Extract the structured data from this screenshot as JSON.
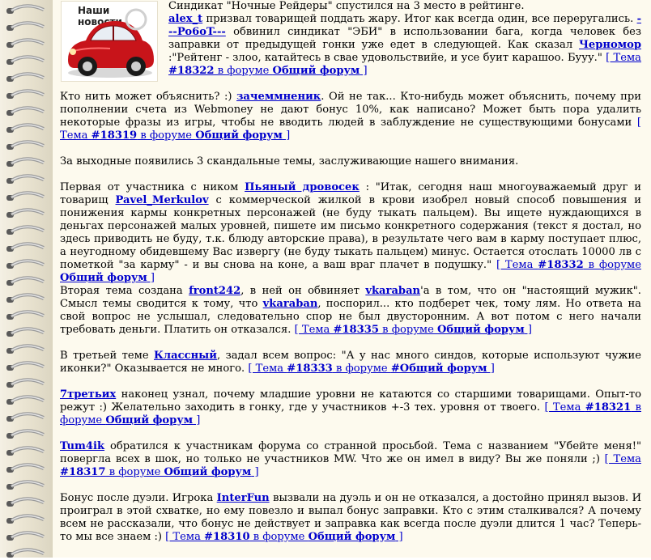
{
  "image": {
    "label": "Наши новости"
  },
  "p1": {
    "lead": "Синдикат \"Ночные Рейдеры\" спустился на 3 место в рейтинге.",
    "u1": "alex_t",
    "t1": " призвал товарищей поддать жару. Итог как всегда один, все переругались.",
    "u2": "---Po6oT---",
    "t2": " обвинил синдикат \"ЭБИ\" в использовании бага, когда человек без заправки от предыдущей гонки уже едет в следующей. Как сказал ",
    "u3": "Черномор",
    "t3": " :\"Рейтенг - злоо, катайтесь в свае удовольствийе, и усе буит карашоо. Бууу.\" ",
    "link_pre": "[ Тема ",
    "link_num": "#18322",
    "link_mid": " в форуме ",
    "link_forum": "Общий форум",
    "link_post": " ]"
  },
  "p2": {
    "t0": "Кто нить может объяснить? :) ",
    "u1": "зачеммненик",
    "t1": ". Ой не так... Кто-нибудь может объяснить, почему при пополнении счета из Webmoney не дают бонус 10%, как написано? Может быть пора удалить некоторые фразы из игры, чтобы не вводить людей в заблуждение не существующими бонусами ",
    "link_pre": "[ Тема ",
    "link_num": "#18319",
    "link_mid": " в форуме ",
    "link_forum": "Общий форум",
    "link_post": " ]"
  },
  "p3": {
    "text": "За выходные появились 3 скандальные темы, заслуживающие нашего внимания."
  },
  "p4": {
    "t0": "Первая от участника с ником ",
    "u1": "Пьяный дровосек",
    "t1": " : \"Итак, сегодня наш многоуважаемый друг и товарищ ",
    "u2": "Pavel_Merkulov",
    "t2": " с коммерческой жилкой в крови изобрел новый способ повышения и понижения кармы конкретных персонажей (не буду тыкать пальцем). Вы ищете нуждающихся в деньгах персонажей малых уровней, пишете им письмо конкретного содержания (текст я достал, но здесь приводить не буду, т.к. блюду авторские права), в результате чего вам в карму поступает плюс, а неугодному обидевшему Вас извергу (не буду тыкать пальцем) минус. Остается отослать 10000 лв с пометкой \"за карму\" - и вы снова на коне, а ваш враг плачет в подушку.\" ",
    "link_pre": "[ Тема ",
    "link_num": "#18332",
    "link_mid": " в форуме ",
    "link_forum": "Общий форум",
    "link_post": " ]"
  },
  "p5": {
    "t0": "Вторая тема создана ",
    "u1": "front242",
    "t1": ", в ней он обвиняет ",
    "u2": "vkaraban",
    "t2": "'а в том, что он \"настоящий мужик\". Смысл темы сводится к тому, что ",
    "u3": "vkaraban",
    "t3": ", поспорил... кто подберет чек, тому лям. Но ответа на свой вопрос не услышал, следовательно спор не был двусторонним. А вот потом с него начали требовать деньги. Платить он отказался. ",
    "link_pre": "[ Тема ",
    "link_num": "#18335",
    "link_mid": " в форуме ",
    "link_forum": "Общий форум",
    "link_post": " ]"
  },
  "p6": {
    "t0": "В третьей теме ",
    "u1": "Классный",
    "t1": ", задал всем вопрос: \"А у нас много синдов, которые используют чужие иконки?\" Оказывается не много. ",
    "link_pre": "[ Тема ",
    "link_num": "#18333",
    "link_mid": " в форуме ",
    "link_forum": "#Общий форум",
    "link_post": " ]"
  },
  "p7": {
    "u1": "7третьих",
    "t1": " наконец узнал, почему младшие уровни не катаются со старшими товарищами. Опыт-то режут :) Желательно заходить в гонку, где у участников +-3 тех. уровня от твоего. ",
    "link_pre": "[ Тема ",
    "link_num": "#18321",
    "link_mid": " в форуме ",
    "link_forum": "Общий форум",
    "link_post": " ]"
  },
  "p8": {
    "u1": "Tum4ik",
    "t1": " обратился к участникам форума со странной просьбой. Тема с названием \"Убейте меня!\" повергла всех в шок, но только не участников MW. Что же он имел в виду? Вы же поняли ;) ",
    "link_pre": "[ Тема ",
    "link_num": "#18317",
    "link_mid": " в форуме ",
    "link_forum": "Общий форум",
    "link_post": " ]"
  },
  "p9": {
    "t0": "Бонус после дуэли. Игрока ",
    "u1": "InterFun",
    "t1": " вызвали на дуэль и он не отказался, а достойно принял вызов. И проиграл в этой схватке, но ему повезло и выпал бонус заправки. Кто с этим сталкивался? А почему всем не рассказали, что бонус не действует и заправка как всегда после дуэли длится 1 час? Теперь-то мы все знаем :) ",
    "link_pre": "[ Тема ",
    "link_num": "#18310",
    "link_mid": " в форуме ",
    "link_forum": "Общий форум",
    "link_post": " ]"
  },
  "colors": {
    "link": "#0000cc",
    "page_bg": "#fdfaee",
    "car_red": "#c8141a"
  }
}
